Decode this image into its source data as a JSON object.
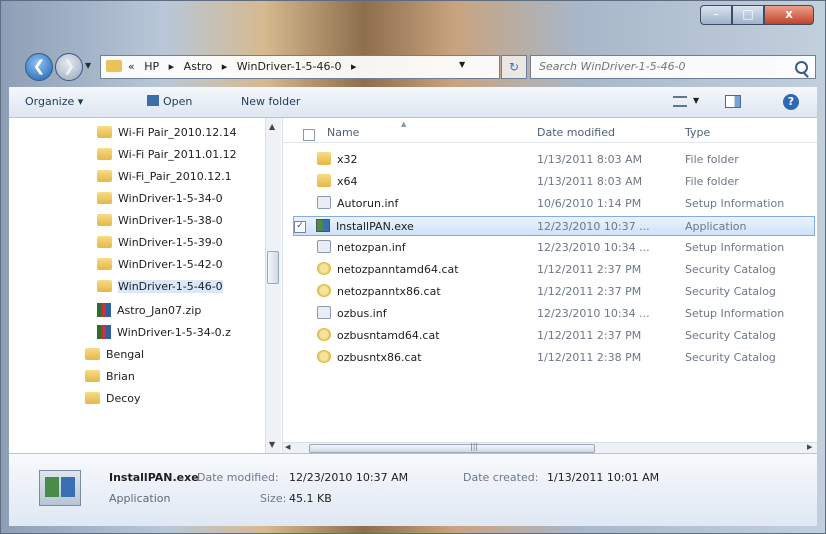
{
  "window": {
    "minimize_label": "–",
    "maximize_label": "□",
    "close_label": "x"
  },
  "address": {
    "chevron": "«",
    "crumbs": [
      "HP",
      "Astro",
      "WinDriver-1-5-46-0"
    ],
    "separator": "▸",
    "dropdown": "▼",
    "refresh_icon": "↻"
  },
  "search": {
    "placeholder": "Search WinDriver-1-5-46-0"
  },
  "toolbar": {
    "organize_label": "Organize ▾",
    "open_label": "Open",
    "new_folder_label": "New folder",
    "help_label": "?"
  },
  "nav_pane": {
    "items": [
      {
        "label": "Wi-Fi Pair_2010.12.14",
        "icon": "folder-icon"
      },
      {
        "label": "Wi-Fi Pair_2011.01.12",
        "icon": "folder-icon"
      },
      {
        "label": "Wi-Fi_Pair_2010.12.1",
        "icon": "folder-icon"
      },
      {
        "label": "WinDriver-1-5-34-0",
        "icon": "folder-icon"
      },
      {
        "label": "WinDriver-1-5-38-0",
        "icon": "folder-icon"
      },
      {
        "label": "WinDriver-1-5-39-0",
        "icon": "folder-icon"
      },
      {
        "label": "WinDriver-1-5-42-0",
        "icon": "folder-icon"
      },
      {
        "label": "WinDriver-1-5-46-0",
        "icon": "folder-icon",
        "selected": true
      },
      {
        "label": "Astro_Jan07.zip",
        "icon": "zip-icon"
      },
      {
        "label": "WinDriver-1-5-34-0.z",
        "icon": "zip-icon"
      },
      {
        "label": "Bengal",
        "icon": "folder-icon"
      },
      {
        "label": "Brian",
        "icon": "folder-icon"
      },
      {
        "label": "Decoy",
        "icon": "folder-icon"
      }
    ]
  },
  "file_list": {
    "columns": {
      "name": "Name",
      "date_modified": "Date modified",
      "type": "Type"
    },
    "rows": [
      {
        "name": "x32",
        "date": "1/13/2011 8:03 AM",
        "type": "File folder",
        "icon": "folder-icon"
      },
      {
        "name": "x64",
        "date": "1/13/2011 8:03 AM",
        "type": "File folder",
        "icon": "folder-icon"
      },
      {
        "name": "Autorun.inf",
        "date": "10/6/2010 1:14 PM",
        "type": "Setup Information",
        "icon": "inf-icon"
      },
      {
        "name": "InstallPAN.exe",
        "date": "12/23/2010 10:37 ...",
        "type": "Application",
        "icon": "exe-icon",
        "selected": true,
        "checked": true
      },
      {
        "name": "netozpan.inf",
        "date": "12/23/2010 10:34 ...",
        "type": "Setup Information",
        "icon": "inf-icon"
      },
      {
        "name": "netozpanntamd64.cat",
        "date": "1/12/2011 2:37 PM",
        "type": "Security Catalog",
        "icon": "cat-icon"
      },
      {
        "name": "netozpanntx86.cat",
        "date": "1/12/2011 2:37 PM",
        "type": "Security Catalog",
        "icon": "cat-icon"
      },
      {
        "name": "ozbus.inf",
        "date": "12/23/2010 10:34 ...",
        "type": "Setup Information",
        "icon": "inf-icon"
      },
      {
        "name": "ozbusntamd64.cat",
        "date": "1/12/2011 2:37 PM",
        "type": "Security Catalog",
        "icon": "cat-icon"
      },
      {
        "name": "ozbusntx86.cat",
        "date": "1/12/2011 2:38 PM",
        "type": "Security Catalog",
        "icon": "cat-icon"
      }
    ]
  },
  "details": {
    "name": "InstallPAN.exe",
    "type": "Application",
    "date_modified_label": "Date modified:",
    "date_modified": "12/23/2010 10:37 AM",
    "date_created_label": "Date created:",
    "date_created": "1/13/2011 10:01 AM",
    "size_label": "Size:",
    "size": "45.1 KB"
  }
}
